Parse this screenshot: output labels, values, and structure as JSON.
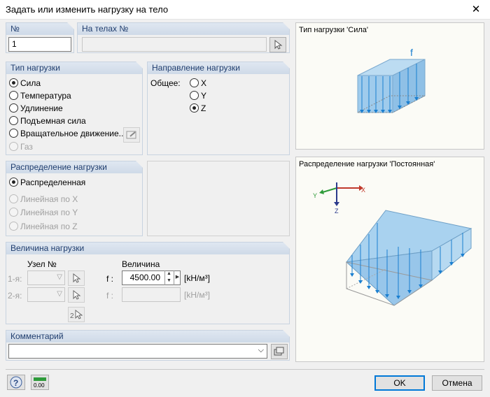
{
  "window": {
    "title": "Задать или изменить нагрузку на тело",
    "close": "✕"
  },
  "no_group": {
    "header": "№",
    "value": "1"
  },
  "bodies_group": {
    "header": "На телах №",
    "value": ""
  },
  "load_type": {
    "header": "Тип нагрузки",
    "options": [
      "Сила",
      "Температура",
      "Удлинение",
      "Подъемная сила",
      "Вращательное движение...",
      "Газ"
    ],
    "selected": "Сила"
  },
  "direction": {
    "header": "Направление нагрузки",
    "general_label": "Общее:",
    "options": [
      "X",
      "Y",
      "Z"
    ],
    "selected": "Z"
  },
  "distribution": {
    "header": "Распределение нагрузки",
    "options": [
      "Распределенная",
      "Линейная по X",
      "Линейная по Y",
      "Линейная по Z"
    ],
    "selected": "Распределенная"
  },
  "magnitude": {
    "header": "Величина нагрузки",
    "node_header": "Узел №",
    "value_header": "Величина",
    "row1_label": "1-я:",
    "row2_label": "2-я:",
    "f_label": "f :",
    "f1_value": "4500.00",
    "f2_value": "",
    "unit": "[kH/м³]"
  },
  "comment": {
    "header": "Комментарий",
    "value": ""
  },
  "preview_type": {
    "title": "Тип нагрузки 'Сила'",
    "f_label": "f"
  },
  "preview_dist": {
    "title": "Распределение нагрузки 'Постоянная'",
    "axis_x": "X",
    "axis_y": "Y",
    "axis_z": "Z"
  },
  "footer": {
    "ok": "OK",
    "cancel": "Отмена",
    "units_icon_text": "0.00"
  }
}
